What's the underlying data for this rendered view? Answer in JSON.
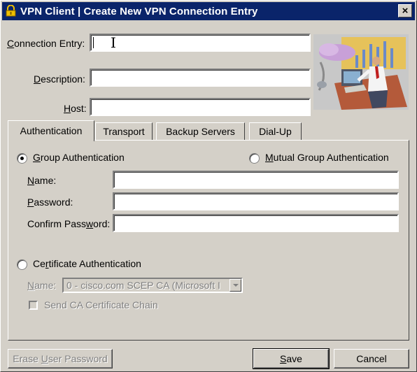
{
  "window": {
    "title": "VPN Client  |  Create New VPN Connection Entry",
    "close_glyph": "×",
    "app_icon": "lock-icon"
  },
  "fields": {
    "connection_entry": {
      "label_u": "C",
      "label_rest": "onnection Entry:",
      "value": ""
    },
    "description": {
      "label_u": "D",
      "label_rest": "escription:",
      "value": ""
    },
    "host": {
      "label_u": "H",
      "label_rest": "ost:",
      "value": ""
    }
  },
  "tabs": [
    {
      "label": "Authentication",
      "active": true
    },
    {
      "label": "Transport",
      "active": false
    },
    {
      "label": "Backup Servers",
      "active": false
    },
    {
      "label": "Dial-Up",
      "active": false
    }
  ],
  "auth": {
    "group_auth": {
      "label_u": "G",
      "label_rest": "roup Authentication",
      "selected": true
    },
    "mutual_auth": {
      "label_u": "M",
      "label_rest": "utual Group Authentication",
      "selected": false
    },
    "name": {
      "label_u": "N",
      "label_rest": "ame:",
      "value": ""
    },
    "password": {
      "label_u": "P",
      "label_rest": "assword:",
      "value": ""
    },
    "confirm_password": {
      "label_pre": "Confirm Pass",
      "label_u": "w",
      "label_rest": "ord:",
      "value": ""
    },
    "cert_auth": {
      "label_pre": "Ce",
      "label_u": "r",
      "label_rest": "tificate Authentication",
      "selected": false
    },
    "cert_name": {
      "label_u": "N",
      "label_rest": "ame:",
      "value": "0 - cisco.com SCEP CA (Microsoft I"
    },
    "send_chain": {
      "label": "Send CA Certificate Chain",
      "checked": false
    }
  },
  "buttons": {
    "erase_pre": "Erase ",
    "erase_u": "U",
    "erase_rest": "ser Password",
    "save_u": "S",
    "save_rest": "ave",
    "cancel": "Cancel"
  }
}
